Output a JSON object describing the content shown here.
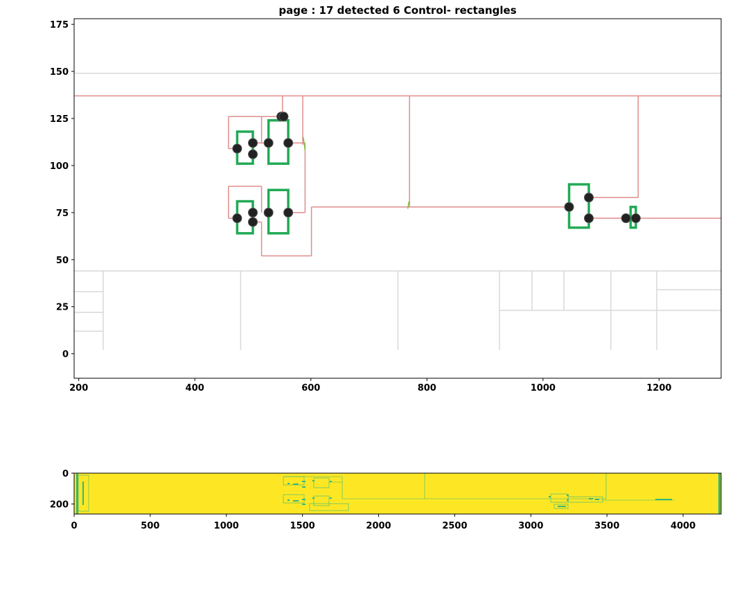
{
  "chart_data": [
    {
      "type": "scatter",
      "title": "page : 17 detected 6 Control- rectangles",
      "xlabel": "",
      "ylabel": "",
      "xlim": [
        192,
        1307
      ],
      "ylim": [
        -13,
        178
      ],
      "xticks": [
        200,
        400,
        600,
        800,
        1000,
        1200
      ],
      "yticks": [
        0,
        25,
        50,
        75,
        100,
        125,
        150,
        175
      ],
      "grid": false,
      "background_lines": [
        [
          [
            192,
            149
          ],
          [
            1307,
            149
          ]
        ],
        [
          [
            192,
            44
          ],
          [
            1307,
            44
          ]
        ],
        [
          [
            242,
            44
          ],
          [
            242,
            2
          ]
        ],
        [
          [
            192,
            33
          ],
          [
            242,
            33
          ]
        ],
        [
          [
            192,
            22
          ],
          [
            242,
            22
          ]
        ],
        [
          [
            192,
            12
          ],
          [
            242,
            12
          ]
        ],
        [
          [
            479,
            44
          ],
          [
            479,
            2
          ]
        ],
        [
          [
            750,
            44
          ],
          [
            750,
            2
          ]
        ],
        [
          [
            925,
            44
          ],
          [
            925,
            2
          ]
        ],
        [
          [
            981,
            44
          ],
          [
            981,
            23
          ]
        ],
        [
          [
            1036,
            44
          ],
          [
            1036,
            23
          ]
        ],
        [
          [
            925,
            23
          ],
          [
            1307,
            23
          ]
        ],
        [
          [
            1117,
            44
          ],
          [
            1117,
            2
          ]
        ],
        [
          [
            1196,
            44
          ],
          [
            1196,
            2
          ]
        ],
        [
          [
            1196,
            34
          ],
          [
            1307,
            34
          ]
        ]
      ],
      "wires": [
        [
          [
            192,
            137
          ],
          [
            1307,
            137
          ]
        ],
        [
          [
            551,
            137
          ],
          [
            551,
            126
          ]
        ],
        [
          [
            586,
            137
          ],
          [
            586,
            111
          ]
        ],
        [
          [
            770,
            137
          ],
          [
            770,
            78
          ]
        ],
        [
          [
            1164,
            137
          ],
          [
            1164,
            83
          ]
        ],
        [
          [
            1079,
            83
          ],
          [
            1164,
            83
          ]
        ],
        [
          [
            601,
            78
          ],
          [
            1045,
            78
          ]
        ],
        [
          [
            601,
            78
          ],
          [
            601,
            52
          ]
        ],
        [
          [
            515,
            52
          ],
          [
            601,
            52
          ]
        ],
        [
          [
            515,
            52
          ],
          [
            515,
            70
          ]
        ],
        [
          [
            515,
            70
          ],
          [
            500,
            70
          ]
        ],
        [
          [
            458,
            126
          ],
          [
            551,
            126
          ]
        ],
        [
          [
            458,
            126
          ],
          [
            458,
            109
          ]
        ],
        [
          [
            458,
            109
          ],
          [
            473,
            109
          ]
        ],
        [
          [
            458,
            89
          ],
          [
            515,
            89
          ]
        ],
        [
          [
            458,
            89
          ],
          [
            458,
            72
          ]
        ],
        [
          [
            458,
            72
          ],
          [
            473,
            72
          ]
        ],
        [
          [
            515,
            89
          ],
          [
            515,
            75
          ]
        ],
        [
          [
            515,
            126
          ],
          [
            515,
            112
          ]
        ],
        [
          [
            500,
            112
          ],
          [
            527,
            112
          ]
        ],
        [
          [
            561,
            112
          ],
          [
            590,
            112
          ]
        ],
        [
          [
            561,
            75
          ],
          [
            590,
            75
          ]
        ],
        [
          [
            590,
            112
          ],
          [
            590,
            75
          ]
        ],
        [
          [
            1079,
            72
          ],
          [
            1307,
            72
          ]
        ],
        [
          [
            1045,
            78
          ],
          [
            1045,
            72
          ]
        ],
        [
          [
            1143,
            72
          ],
          [
            1160,
            72
          ]
        ]
      ],
      "rectangles": [
        {
          "x0": 473,
          "x1": 500,
          "y0": 101,
          "y1": 118
        },
        {
          "x0": 527,
          "x1": 561,
          "y0": 101,
          "y1": 124
        },
        {
          "x0": 473,
          "x1": 500,
          "y0": 64,
          "y1": 81
        },
        {
          "x0": 527,
          "x1": 561,
          "y0": 64,
          "y1": 87
        },
        {
          "x0": 1045,
          "x1": 1079,
          "y0": 67,
          "y1": 90
        },
        {
          "x0": 1151,
          "x1": 1160,
          "y0": 67,
          "y1": 78
        }
      ],
      "points": [
        {
          "x": 473,
          "y": 109
        },
        {
          "x": 500,
          "y": 112
        },
        {
          "x": 500,
          "y": 106
        },
        {
          "x": 527,
          "y": 112
        },
        {
          "x": 561,
          "y": 112
        },
        {
          "x": 549,
          "y": 126
        },
        {
          "x": 553,
          "y": 126
        },
        {
          "x": 473,
          "y": 72
        },
        {
          "x": 500,
          "y": 75
        },
        {
          "x": 500,
          "y": 70
        },
        {
          "x": 527,
          "y": 75
        },
        {
          "x": 561,
          "y": 75
        },
        {
          "x": 1045,
          "y": 78
        },
        {
          "x": 1079,
          "y": 83
        },
        {
          "x": 1079,
          "y": 72
        },
        {
          "x": 1143,
          "y": 72
        },
        {
          "x": 1160,
          "y": 72
        }
      ],
      "colors": {
        "wire": "#e08c8c",
        "background_line": "#d8d8d8",
        "rectangle": "#22aa55",
        "point": "#222222",
        "diagonal_mark": "#7cc242"
      }
    },
    {
      "type": "heatmap",
      "title": "",
      "xlim": [
        0,
        4250
      ],
      "ylim": [
        265,
        0
      ],
      "xticks": [
        0,
        500,
        1000,
        1500,
        2000,
        2500,
        3000,
        3500,
        4000
      ],
      "yticks": [
        0,
        200
      ],
      "background_color": "#fde725",
      "line_color": "#35b779"
    }
  ]
}
